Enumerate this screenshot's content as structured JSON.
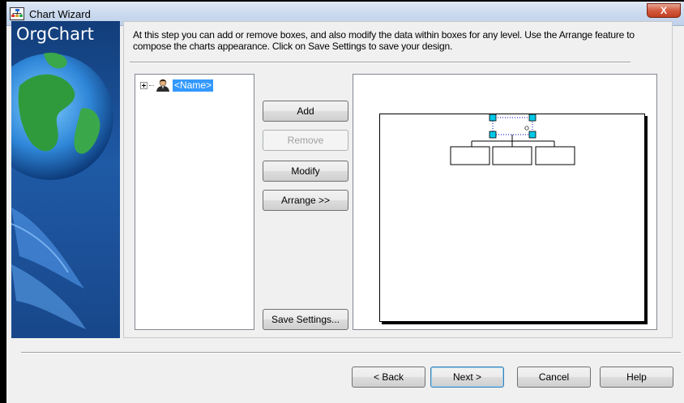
{
  "window": {
    "title": "Chart Wizard",
    "close_label": "X"
  },
  "banner": {
    "title": "OrgChart"
  },
  "instruction": "At this step you can add or remove boxes, and also modify the data within boxes for any level. Use the Arrange feature to compose the charts appearance.  Click on Save Settings to save your design.",
  "tree": {
    "items": [
      {
        "label": "<Name>",
        "icon": "person-icon",
        "selected": true,
        "expandable": true
      }
    ]
  },
  "actions": {
    "add": "Add",
    "remove": "Remove",
    "modify": "Modify",
    "arrange": "Arrange >>",
    "save_settings": "Save Settings..."
  },
  "footer": {
    "back": "< Back",
    "next": "Next >",
    "cancel": "Cancel",
    "help": "Help"
  },
  "colors": {
    "selection": "#3399ff",
    "handle": "#00c8e6",
    "banner": "#1f5aa6"
  }
}
